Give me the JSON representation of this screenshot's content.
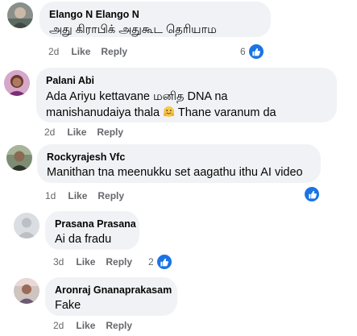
{
  "comments": [
    {
      "author": "Elango N Elango N",
      "text": "அது கிராபிக் அதுகூட தெரியாம",
      "time": "2d",
      "like": "Like",
      "reply": "Reply",
      "reactions": "6"
    },
    {
      "author": "Palani Abi",
      "text1": "Ada Ariyu kettavane மனித DNA na",
      "text2a": "manishanudaiya thala",
      "text2b": "Thane varanum da",
      "time": "2d",
      "like": "Like",
      "reply": "Reply"
    },
    {
      "author": "Rockyrajesh Vfc",
      "text": "Manithan tna meenukku set aagathu ithu AI video",
      "time": "1d",
      "like": "Like",
      "reply": "Reply"
    },
    {
      "author": "Prasana Prasana",
      "text": "Ai da fradu",
      "time": "3d",
      "like": "Like",
      "reply": "Reply",
      "reactions": "2"
    },
    {
      "author": "Aronraj Gnanaprakasam",
      "text": "Fake",
      "time": "2d",
      "like": "Like",
      "reply": "Reply"
    }
  ],
  "colors": {
    "bubble": "#f0f2f5",
    "like_blue": "#1b74e4",
    "meta_gray": "#65676b"
  },
  "icons": {
    "reaction": "like-thumbs-up-icon",
    "emoji": "hugging-face-emoji-icon"
  }
}
